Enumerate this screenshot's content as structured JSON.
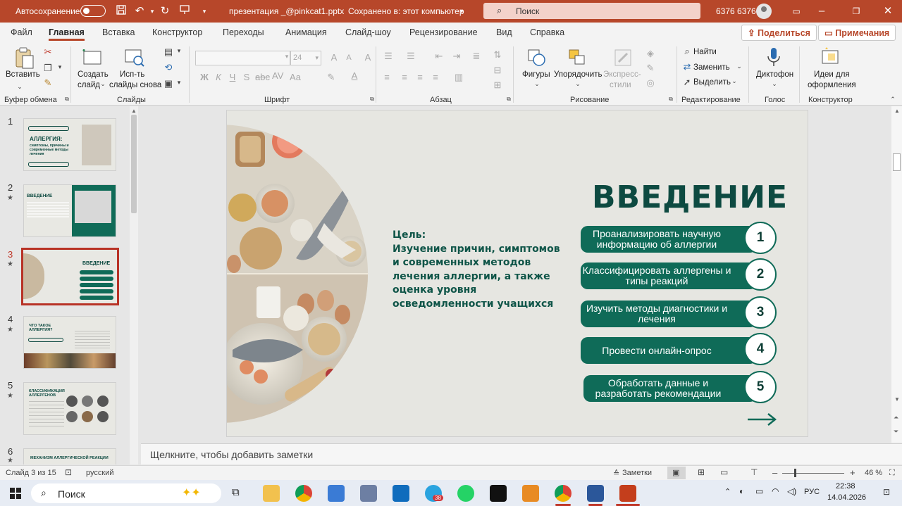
{
  "titlebar": {
    "autosave_label": "Автосохранение",
    "doc_name": "презентация _@pinkcat1.pptx",
    "save_state": "Сохранено в: этот компьютер",
    "search_placeholder": "Поиск",
    "user": "6376 6376"
  },
  "menu": {
    "tabs": [
      "Файл",
      "Главная",
      "Вставка",
      "Конструктор",
      "Переходы",
      "Анимация",
      "Слайд-шоу",
      "Рецензирование",
      "Вид",
      "Справка"
    ],
    "share": "Поделиться",
    "comments": "Примечания"
  },
  "ribbon": {
    "clipboard": {
      "paste": "Вставить",
      "group": "Буфер обмена"
    },
    "slides": {
      "new_slide_1": "Создать",
      "new_slide_2": "слайд",
      "reuse_1": "Исп-ть",
      "reuse_2": "слайды снова",
      "group": "Слайды"
    },
    "font": {
      "size": "24",
      "group": "Шрифт"
    },
    "paragraph": {
      "group": "Абзац"
    },
    "drawing": {
      "shapes": "Фигуры",
      "arrange": "Упорядочить",
      "styles_1": "Экспресс-",
      "styles_2": "стили",
      "group": "Рисование"
    },
    "editing": {
      "find": "Найти",
      "replace": "Заменить",
      "select": "Выделить",
      "group": "Редактирование"
    },
    "voice": {
      "dictate": "Диктофон",
      "group": "Голос"
    },
    "designer": {
      "ideas_1": "Идеи для",
      "ideas_2": "оформления",
      "group": "Конструктор"
    }
  },
  "thumbnails": [
    {
      "num": "1",
      "title": "АЛЛЕРГИЯ:",
      "sub": "симптомы, причины и современные методы лечения"
    },
    {
      "num": "2",
      "title": "ВВЕДЕНИЕ"
    },
    {
      "num": "3",
      "title": "ВВЕДЕНИЕ"
    },
    {
      "num": "4",
      "title": "ЧТО ТАКОЕ АЛЛЕРГИЯ?"
    },
    {
      "num": "5",
      "title": "КЛАССИФИКАЦИЯ АЛЛЕРГЕНОВ"
    },
    {
      "num": "6",
      "title": "МЕХАНИЗМ АЛЛЕРГИЧЕСКОЙ РЕАКЦИИ"
    }
  ],
  "slide": {
    "title": "ВВЕДЕНИЕ",
    "goal_label": "Цель:",
    "goal_text": "Изучение причин, симптомов и современных методов лечения аллергии, а также оценка уровня осведомленности учащихся",
    "steps": [
      {
        "num": "1",
        "text": "Проанализировать научную информацию об аллергии"
      },
      {
        "num": "2",
        "text": "Классифицировать аллергены и типы реакций"
      },
      {
        "num": "3",
        "text": "Изучить методы диагностики и лечения"
      },
      {
        "num": "4",
        "text": "Провести онлайн-опрос"
      },
      {
        "num": "5",
        "text": "Обработать данные и разработать рекомендации"
      }
    ],
    "accent": "#0f6b58"
  },
  "notes_placeholder": "Щелкните, чтобы добавить заметки",
  "status": {
    "slide_counter": "Слайд 3 из 15",
    "language": "русский",
    "notes": "Заметки",
    "zoom": "46 %"
  },
  "taskbar": {
    "search": "Поиск",
    "telegram_badge": "38",
    "lang": "РУС",
    "time": "22:38",
    "date": "14.04.2026"
  }
}
